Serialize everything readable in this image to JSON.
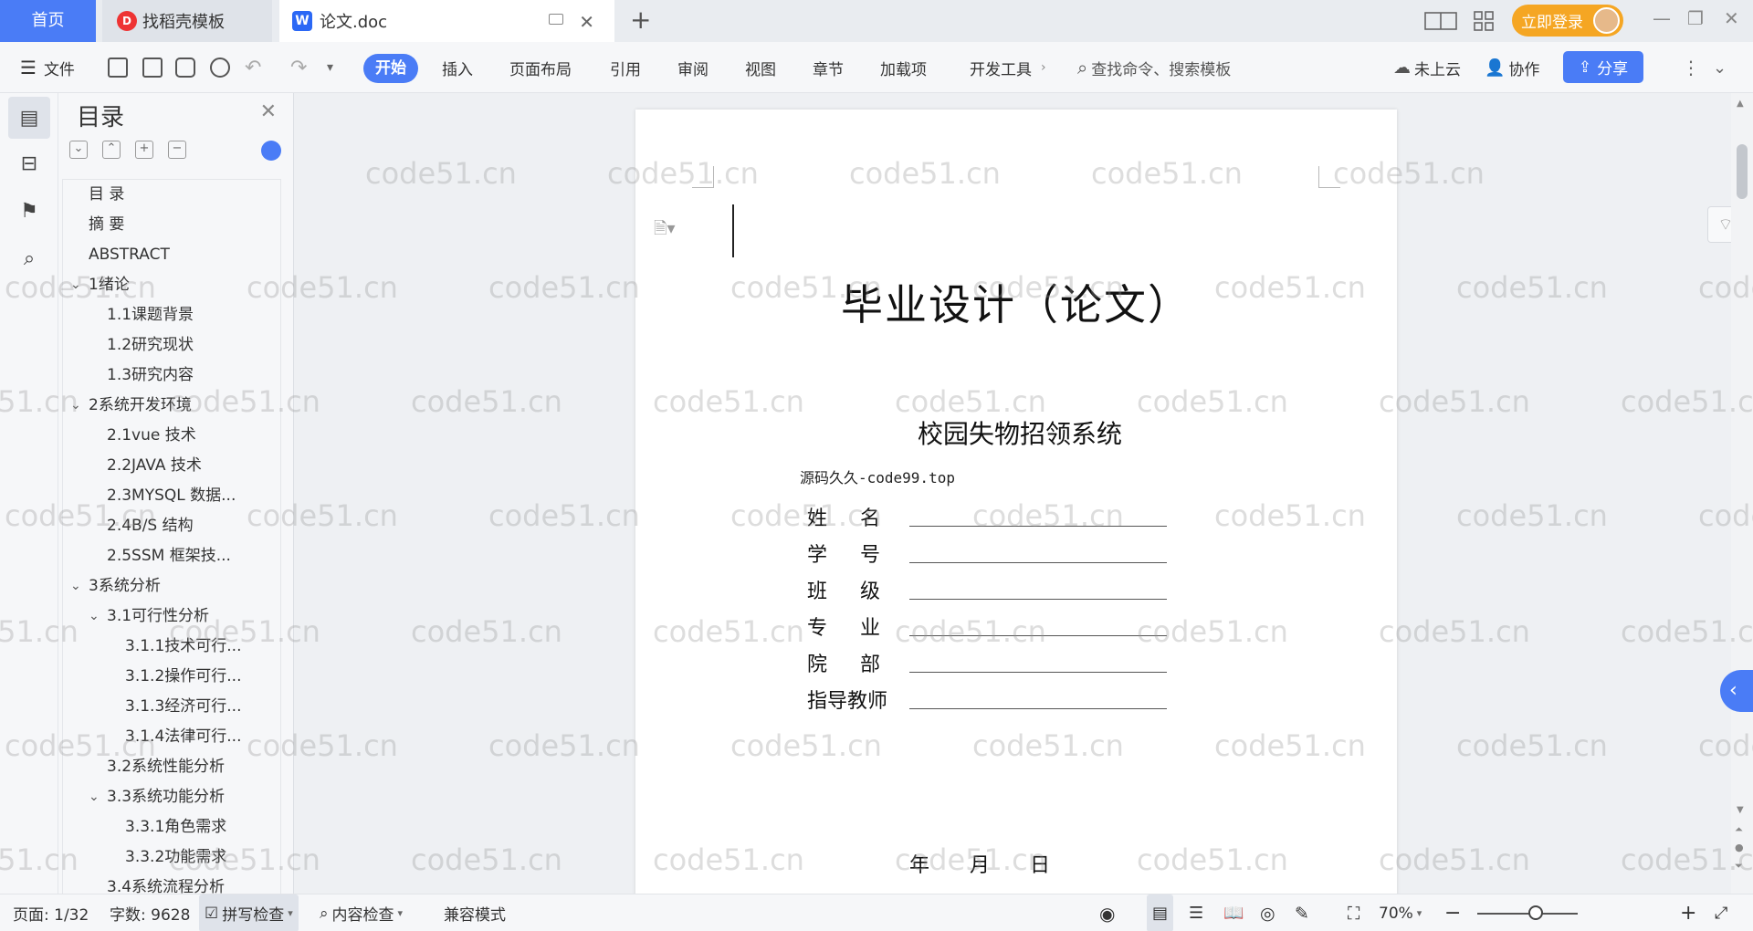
{
  "tabs": {
    "home": "首页",
    "template": "找稻壳模板",
    "document": "论文.doc"
  },
  "header_right": {
    "login": "立即登录"
  },
  "toolbar": {
    "file": "文件",
    "menus": [
      "开始",
      "插入",
      "页面布局",
      "引用",
      "审阅",
      "视图",
      "章节",
      "加载项",
      "开发工具"
    ],
    "search_placeholder": "查找命令、搜索模板",
    "cloud": "未上云",
    "collab": "协作",
    "share": "分享"
  },
  "toc": {
    "title": "目录",
    "items": [
      {
        "label": "目 录",
        "level": 1,
        "arrow": false
      },
      {
        "label": "摘   要",
        "level": 1,
        "arrow": false
      },
      {
        "label": "ABSTRACT",
        "level": 1,
        "arrow": false
      },
      {
        "label": "1绪论",
        "level": 1,
        "arrow": true
      },
      {
        "label": "1.1课题背景",
        "level": 2,
        "arrow": false
      },
      {
        "label": "1.2研究现状",
        "level": 2,
        "arrow": false
      },
      {
        "label": "1.3研究内容",
        "level": 2,
        "arrow": false
      },
      {
        "label": "2系统开发环境",
        "level": 1,
        "arrow": true
      },
      {
        "label": "2.1vue 技术",
        "level": 2,
        "arrow": false
      },
      {
        "label": "2.2JAVA 技术",
        "level": 2,
        "arrow": false
      },
      {
        "label": "2.3MYSQL 数据...",
        "level": 2,
        "arrow": false
      },
      {
        "label": "2.4B/S 结构",
        "level": 2,
        "arrow": false
      },
      {
        "label": "2.5SSM 框架技...",
        "level": 2,
        "arrow": false
      },
      {
        "label": "3系统分析",
        "level": 1,
        "arrow": true
      },
      {
        "label": "3.1可行性分析",
        "level": 2,
        "arrow": true
      },
      {
        "label": "3.1.1技术可行...",
        "level": 3,
        "arrow": false
      },
      {
        "label": "3.1.2操作可行...",
        "level": 3,
        "arrow": false
      },
      {
        "label": "3.1.3经济可行...",
        "level": 3,
        "arrow": false
      },
      {
        "label": "3.1.4法律可行...",
        "level": 3,
        "arrow": false
      },
      {
        "label": "3.2系统性能分析",
        "level": 2,
        "arrow": false
      },
      {
        "label": "3.3系统功能分析",
        "level": 2,
        "arrow": true
      },
      {
        "label": "3.3.1角色需求",
        "level": 3,
        "arrow": false
      },
      {
        "label": "3.3.2功能需求",
        "level": 3,
        "arrow": false
      },
      {
        "label": "3.4系统流程分析",
        "level": 2,
        "arrow": false
      }
    ]
  },
  "document": {
    "title": "毕业设计（论文）",
    "subtitle": "校园失物招领系统",
    "source": "源码久久-code99.top",
    "fields": [
      {
        "label_chars": [
          "姓",
          "名"
        ]
      },
      {
        "label_chars": [
          "学",
          "号"
        ]
      },
      {
        "label_chars": [
          "班",
          "级"
        ]
      },
      {
        "label_chars": [
          "专",
          "业"
        ]
      },
      {
        "label_chars": [
          "院",
          "部"
        ]
      },
      {
        "label_chars": [
          "指",
          "导",
          "教",
          "师"
        ]
      }
    ],
    "date": [
      "年",
      "月",
      "日"
    ]
  },
  "status": {
    "page": "页面: 1/32",
    "words": "字数: 9628",
    "spell": "拼写检查",
    "content": "内容检查",
    "compat": "兼容模式",
    "zoom": "70%"
  },
  "watermark": "code51.cn"
}
